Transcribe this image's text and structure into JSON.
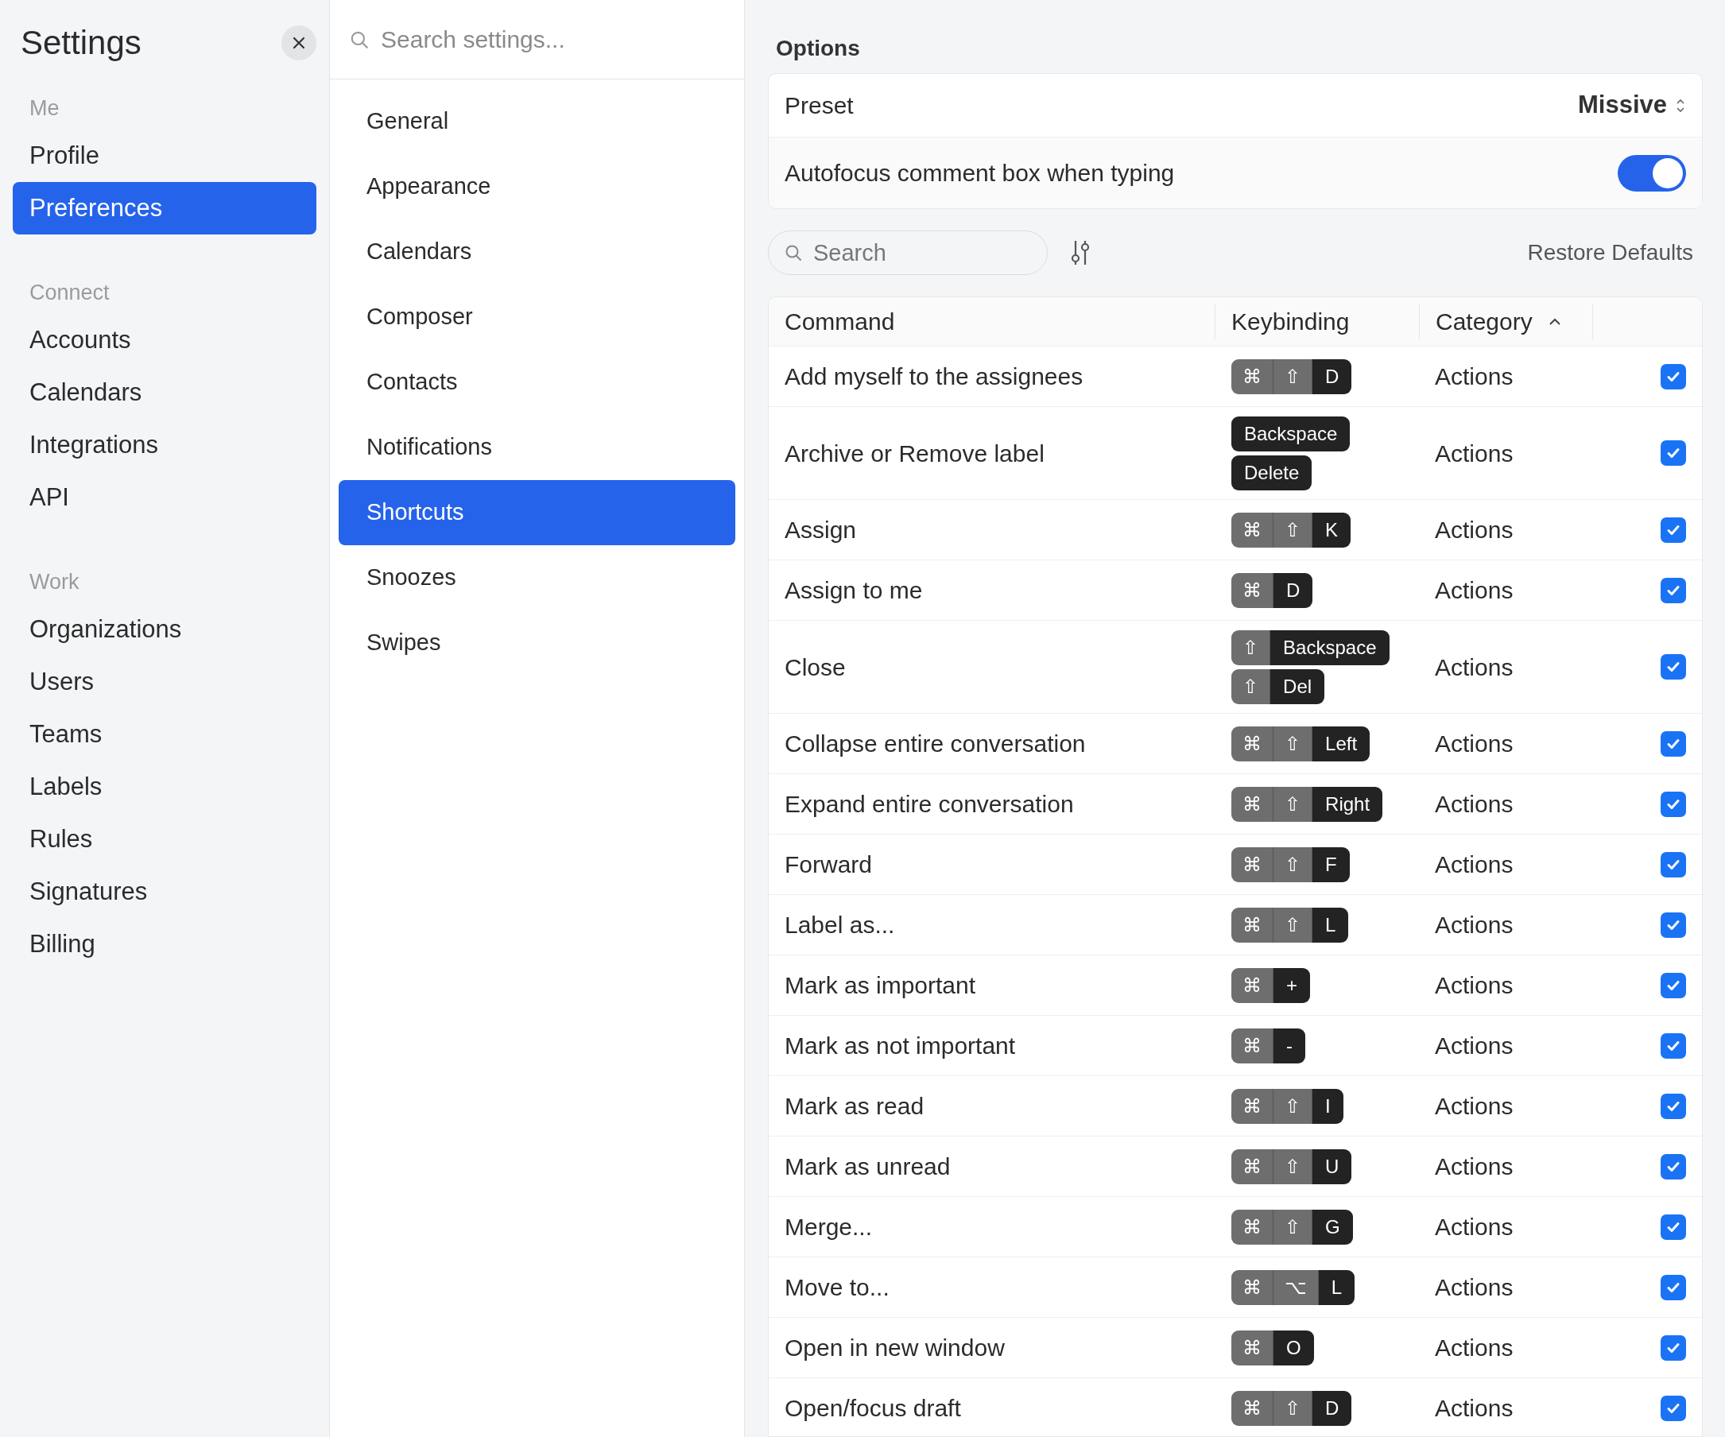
{
  "sidebar": {
    "title": "Settings",
    "sections": [
      {
        "heading": "Me",
        "items": [
          {
            "label": "Profile",
            "selected": false
          },
          {
            "label": "Preferences",
            "selected": true
          }
        ]
      },
      {
        "heading": "Connect",
        "items": [
          {
            "label": "Accounts",
            "selected": false
          },
          {
            "label": "Calendars",
            "selected": false
          },
          {
            "label": "Integrations",
            "selected": false
          },
          {
            "label": "API",
            "selected": false
          }
        ]
      },
      {
        "heading": "Work",
        "items": [
          {
            "label": "Organizations",
            "selected": false
          },
          {
            "label": "Users",
            "selected": false
          },
          {
            "label": "Teams",
            "selected": false
          },
          {
            "label": "Labels",
            "selected": false
          },
          {
            "label": "Rules",
            "selected": false
          },
          {
            "label": "Signatures",
            "selected": false
          },
          {
            "label": "Billing",
            "selected": false
          }
        ]
      }
    ]
  },
  "middle": {
    "search": {
      "placeholder": "Search settings..."
    },
    "items": [
      {
        "label": "General",
        "selected": false
      },
      {
        "label": "Appearance",
        "selected": false
      },
      {
        "label": "Calendars",
        "selected": false
      },
      {
        "label": "Composer",
        "selected": false
      },
      {
        "label": "Contacts",
        "selected": false
      },
      {
        "label": "Notifications",
        "selected": false
      },
      {
        "label": "Shortcuts",
        "selected": true
      },
      {
        "label": "Snoozes",
        "selected": false
      },
      {
        "label": "Swipes",
        "selected": false
      }
    ]
  },
  "options": {
    "heading": "Options",
    "preset": {
      "label": "Preset",
      "value": "Missive"
    },
    "autofocus": {
      "label": "Autofocus comment box when typing",
      "on": true
    }
  },
  "toolbar": {
    "search": {
      "placeholder": "Search"
    },
    "restore": "Restore Defaults"
  },
  "table": {
    "columns": [
      "Command",
      "Keybinding",
      "Category"
    ],
    "rows": [
      {
        "command": "Add myself to the assignees",
        "bindings": [
          [
            {
              "label": "⌘",
              "kind": "modifier"
            },
            {
              "label": "⇧",
              "kind": "modifier"
            },
            {
              "label": "D",
              "kind": "key"
            }
          ]
        ],
        "category": "Actions",
        "checked": true
      },
      {
        "command": "Archive or Remove label",
        "bindings": [
          [
            {
              "label": "Backspace",
              "kind": "key"
            }
          ],
          [
            {
              "label": "Delete",
              "kind": "key"
            }
          ]
        ],
        "category": "Actions",
        "checked": true
      },
      {
        "command": "Assign",
        "bindings": [
          [
            {
              "label": "⌘",
              "kind": "modifier"
            },
            {
              "label": "⇧",
              "kind": "modifier"
            },
            {
              "label": "K",
              "kind": "key"
            }
          ]
        ],
        "category": "Actions",
        "checked": true
      },
      {
        "command": "Assign to me",
        "bindings": [
          [
            {
              "label": "⌘",
              "kind": "modifier"
            },
            {
              "label": "D",
              "kind": "key"
            }
          ]
        ],
        "category": "Actions",
        "checked": true
      },
      {
        "command": "Close",
        "bindings": [
          [
            {
              "label": "⇧",
              "kind": "modifier"
            },
            {
              "label": "Backspace",
              "kind": "key"
            }
          ],
          [
            {
              "label": "⇧",
              "kind": "modifier"
            },
            {
              "label": "Del",
              "kind": "key"
            }
          ]
        ],
        "category": "Actions",
        "checked": true
      },
      {
        "command": "Collapse entire conversation",
        "bindings": [
          [
            {
              "label": "⌘",
              "kind": "modifier"
            },
            {
              "label": "⇧",
              "kind": "modifier"
            },
            {
              "label": "Left",
              "kind": "key"
            }
          ]
        ],
        "category": "Actions",
        "checked": true
      },
      {
        "command": "Expand entire conversation",
        "bindings": [
          [
            {
              "label": "⌘",
              "kind": "modifier"
            },
            {
              "label": "⇧",
              "kind": "modifier"
            },
            {
              "label": "Right",
              "kind": "key"
            }
          ]
        ],
        "category": "Actions",
        "checked": true
      },
      {
        "command": "Forward",
        "bindings": [
          [
            {
              "label": "⌘",
              "kind": "modifier"
            },
            {
              "label": "⇧",
              "kind": "modifier"
            },
            {
              "label": "F",
              "kind": "key"
            }
          ]
        ],
        "category": "Actions",
        "checked": true
      },
      {
        "command": "Label as...",
        "bindings": [
          [
            {
              "label": "⌘",
              "kind": "modifier"
            },
            {
              "label": "⇧",
              "kind": "modifier"
            },
            {
              "label": "L",
              "kind": "key"
            }
          ]
        ],
        "category": "Actions",
        "checked": true
      },
      {
        "command": "Mark as important",
        "bindings": [
          [
            {
              "label": "⌘",
              "kind": "modifier"
            },
            {
              "label": "+",
              "kind": "key"
            }
          ]
        ],
        "category": "Actions",
        "checked": true
      },
      {
        "command": "Mark as not important",
        "bindings": [
          [
            {
              "label": "⌘",
              "kind": "modifier"
            },
            {
              "label": "-",
              "kind": "key"
            }
          ]
        ],
        "category": "Actions",
        "checked": true
      },
      {
        "command": "Mark as read",
        "bindings": [
          [
            {
              "label": "⌘",
              "kind": "modifier"
            },
            {
              "label": "⇧",
              "kind": "modifier"
            },
            {
              "label": "I",
              "kind": "key"
            }
          ]
        ],
        "category": "Actions",
        "checked": true
      },
      {
        "command": "Mark as unread",
        "bindings": [
          [
            {
              "label": "⌘",
              "kind": "modifier"
            },
            {
              "label": "⇧",
              "kind": "modifier"
            },
            {
              "label": "U",
              "kind": "key"
            }
          ]
        ],
        "category": "Actions",
        "checked": true
      },
      {
        "command": "Merge...",
        "bindings": [
          [
            {
              "label": "⌘",
              "kind": "modifier"
            },
            {
              "label": "⇧",
              "kind": "modifier"
            },
            {
              "label": "G",
              "kind": "key"
            }
          ]
        ],
        "category": "Actions",
        "checked": true
      },
      {
        "command": "Move to...",
        "bindings": [
          [
            {
              "label": "⌘",
              "kind": "modifier"
            },
            {
              "label": "⌥",
              "kind": "modifier"
            },
            {
              "label": "L",
              "kind": "key"
            }
          ]
        ],
        "category": "Actions",
        "checked": true
      },
      {
        "command": "Open in new window",
        "bindings": [
          [
            {
              "label": "⌘",
              "kind": "modifier"
            },
            {
              "label": "O",
              "kind": "key"
            }
          ]
        ],
        "category": "Actions",
        "checked": true
      },
      {
        "command": "Open/focus draft",
        "bindings": [
          [
            {
              "label": "⌘",
              "kind": "modifier"
            },
            {
              "label": "⇧",
              "kind": "modifier"
            },
            {
              "label": "D",
              "kind": "key"
            }
          ]
        ],
        "category": "Actions",
        "checked": true
      }
    ]
  }
}
